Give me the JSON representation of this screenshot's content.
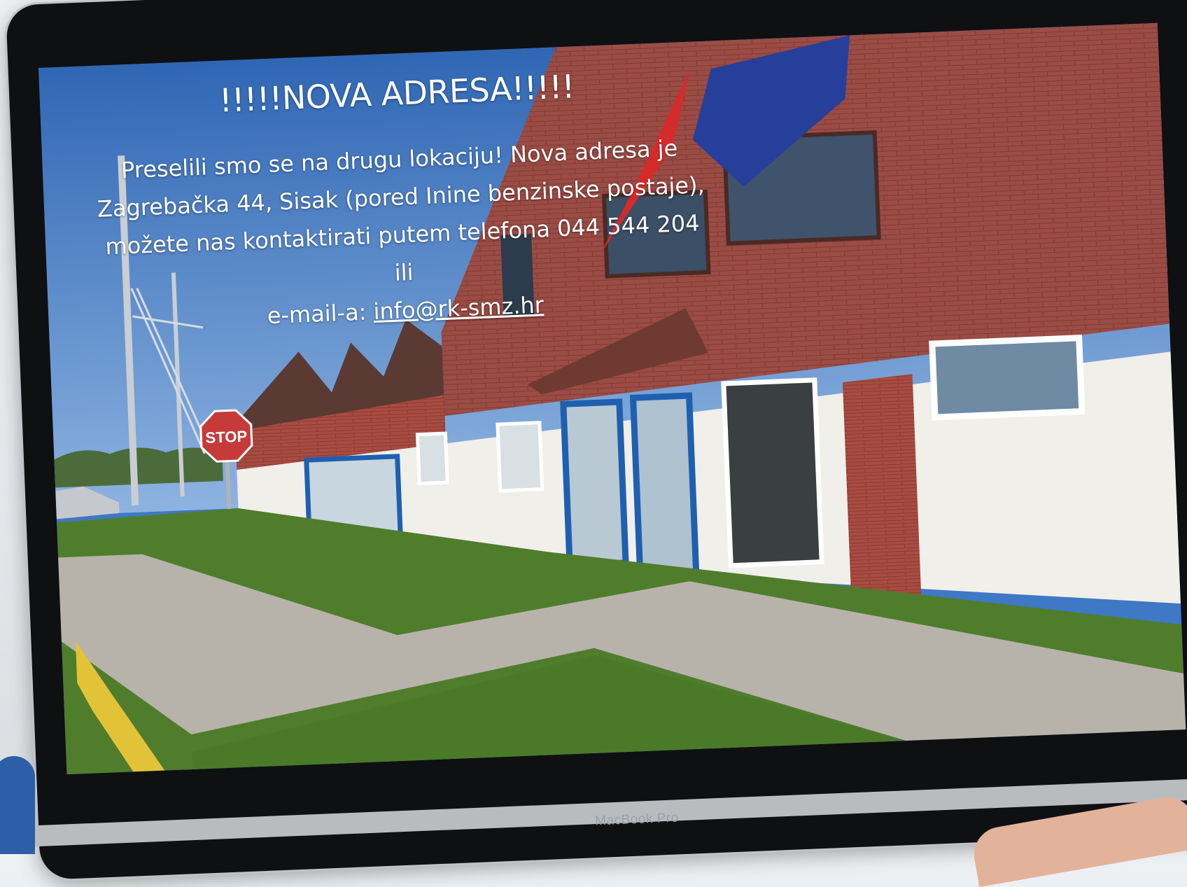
{
  "banner": {
    "headline": "!!!!!NOVA ADRESA!!!!!",
    "message": "Preselili smo se na drugu lokaciju! Nova adresa je Zagrebačka 44, Sisak (pored Inine benzinske postaje), možete nas kontaktirati putem telefona 044 544 204 ili",
    "email_prefix": "e-mail-a: ",
    "email": "info@rk-smz.hr"
  },
  "sign": {
    "stop_text": "STOP"
  },
  "device": {
    "brand_label": "MacBook Pro"
  },
  "colors": {
    "sky": "#3f78c4",
    "facade_brick": "#9b4c45",
    "wall_white": "#f0efe9",
    "door_blue": "#1f5fb0",
    "grass": "#4f7d2c",
    "pavement": "#b7b3aa",
    "curb_yellow": "#e2c337"
  }
}
